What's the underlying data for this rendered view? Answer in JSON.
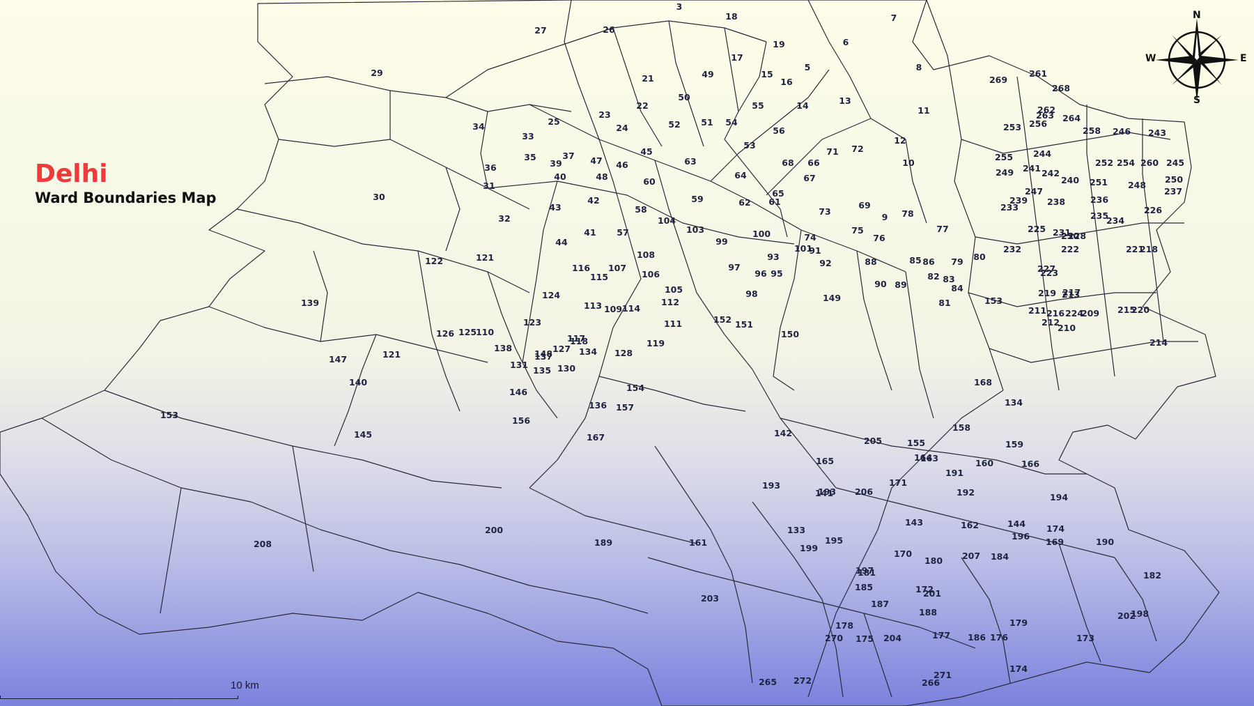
{
  "title": "Delhi",
  "subtitle": "Ward Boundaries Map",
  "scale_bar": {
    "label": "10 km"
  },
  "compass": {
    "north": "N",
    "south": "S",
    "east": "E",
    "west": "W"
  },
  "colors": {
    "title": "#f0393a",
    "boundary": "#2a2a3a",
    "label": "#1f2340",
    "background_top": "#fdfde9",
    "background_mid": "#eeeeec",
    "background_bottom": "#7b82dd"
  },
  "ward_labels": [
    "3",
    "18",
    "7",
    "27",
    "26",
    "19",
    "6",
    "17",
    "5",
    "8",
    "49",
    "29",
    "15",
    "16",
    "21",
    "13",
    "50",
    "22",
    "14",
    "55",
    "11",
    "23",
    "25",
    "52",
    "51",
    "54",
    "56",
    "24",
    "34",
    "33",
    "53",
    "71",
    "72",
    "12",
    "45",
    "35",
    "37",
    "47",
    "63",
    "68",
    "66",
    "39",
    "36",
    "46",
    "10",
    "40",
    "48",
    "64",
    "60",
    "67",
    "65",
    "31",
    "59",
    "62",
    "61",
    "69",
    "9",
    "78",
    "73",
    "32",
    "58",
    "42",
    "30",
    "43",
    "104",
    "103",
    "44",
    "57",
    "41",
    "75",
    "74",
    "76",
    "77",
    "100",
    "99",
    "121",
    "108",
    "101",
    "91",
    "85",
    "86",
    "88",
    "79",
    "80",
    "122",
    "93",
    "107",
    "106",
    "97",
    "116",
    "115",
    "92",
    "105",
    "95",
    "96",
    "90",
    "89",
    "82",
    "83",
    "84",
    "139",
    "124",
    "98",
    "112",
    "149",
    "81",
    "153",
    "113",
    "109",
    "114",
    "123",
    "152",
    "151",
    "111",
    "126",
    "125",
    "117",
    "150",
    "110",
    "119",
    "118",
    "127",
    "134",
    "128",
    "138",
    "148",
    "121",
    "137",
    "147",
    "131",
    "135",
    "140",
    "130",
    "146",
    "154",
    "153",
    "136",
    "157",
    "168",
    "134",
    "145",
    "156",
    "158",
    "142",
    "167",
    "159",
    "155",
    "205",
    "165",
    "166",
    "163",
    "164",
    "160",
    "193",
    "193",
    "206",
    "141",
    "171",
    "191",
    "192",
    "194",
    "200",
    "133",
    "143",
    "144",
    "174",
    "196",
    "208",
    "189",
    "161",
    "162",
    "195",
    "199",
    "190",
    "169",
    "184",
    "180",
    "207",
    "170",
    "197",
    "182",
    "185",
    "172",
    "181",
    "201",
    "203",
    "188",
    "198",
    "202",
    "179",
    "173",
    "187",
    "204",
    "186",
    "178",
    "175",
    "176",
    "177",
    "174",
    "271",
    "265",
    "272",
    "266",
    "270",
    "261",
    "268",
    "269",
    "262",
    "263",
    "264",
    "256",
    "253",
    "258",
    "246",
    "243",
    "244",
    "255",
    "252",
    "254",
    "260",
    "245",
    "241",
    "242",
    "249",
    "240",
    "251",
    "248",
    "250",
    "247",
    "237",
    "239",
    "238",
    "233",
    "236",
    "235",
    "226",
    "234",
    "225",
    "231",
    "230",
    "232",
    "221",
    "222",
    "228",
    "227",
    "218",
    "223",
    "217",
    "219",
    "213",
    "216",
    "224",
    "209",
    "220",
    "210",
    "215",
    "211",
    "214",
    "212"
  ]
}
